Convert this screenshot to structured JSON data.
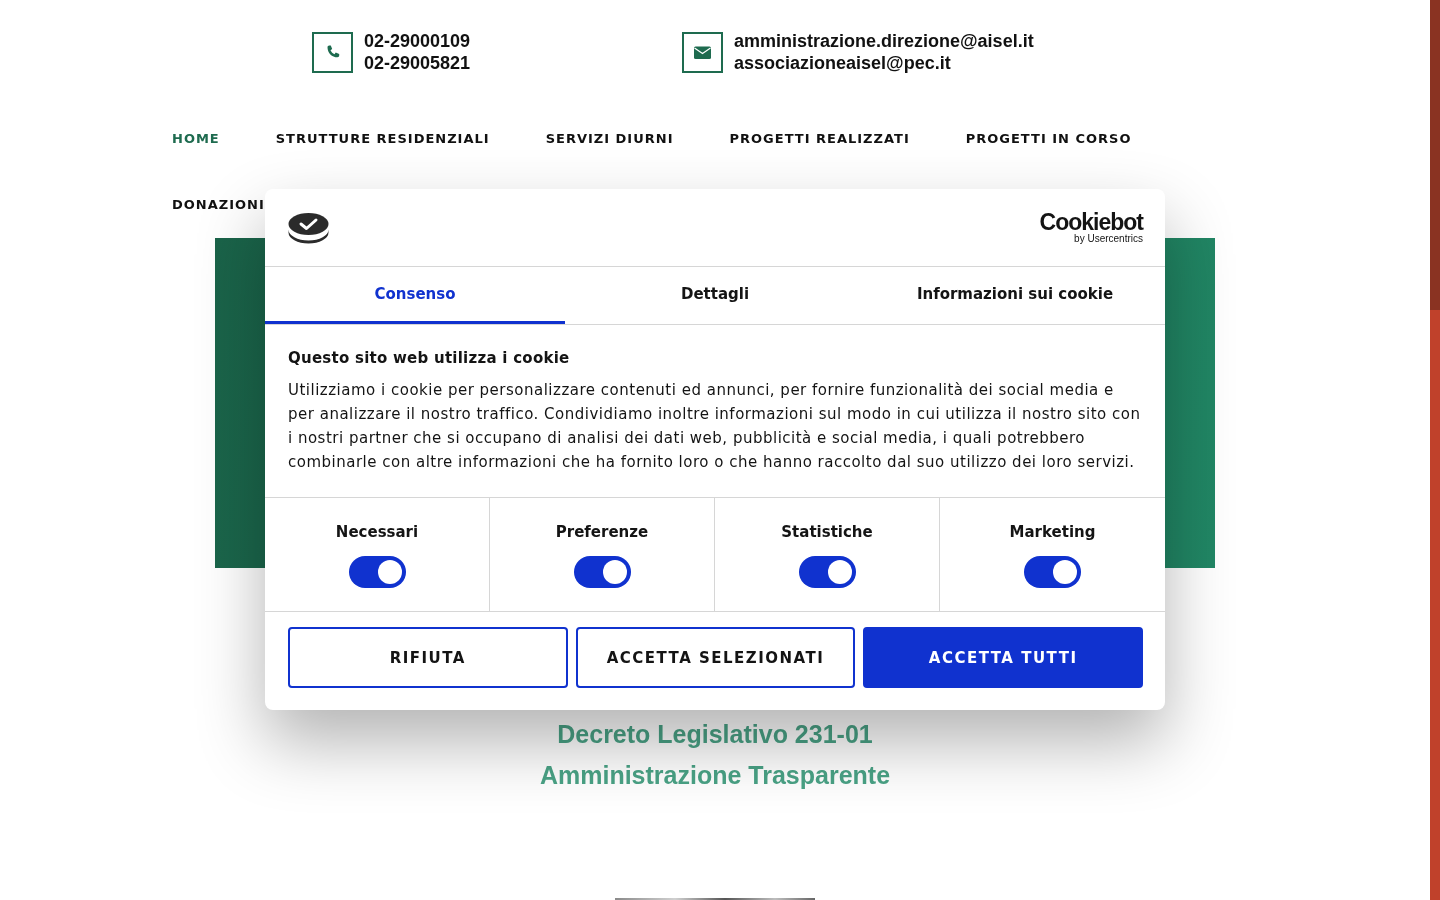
{
  "contacts": [
    {
      "kind": "phone",
      "lines": [
        "02-29000109",
        "02-29005821"
      ]
    },
    {
      "kind": "email",
      "lines": [
        "amministrazione.direzione@aisel.it",
        "associazioneaisel@pec.it"
      ]
    }
  ],
  "nav": [
    {
      "label": "HOME",
      "selected": true
    },
    {
      "label": "STRUTTURE RESIDENZIALI",
      "selected": false
    },
    {
      "label": "SERVIZI DIURNI",
      "selected": false
    },
    {
      "label": "PROGETTI REALIZZATI",
      "selected": false
    },
    {
      "label": "PROGETTI IN CORSO",
      "selected": false
    },
    {
      "label": "DONAZIONI",
      "selected": false
    }
  ],
  "links": [
    "Decreto Legislativo 231-01",
    "Amministrazione Trasparente"
  ],
  "cookie_dialog": {
    "brand": {
      "name": "Cookiebot",
      "tagline": "by Usercentrics"
    },
    "tabs": [
      {
        "label": "Consenso",
        "selected": true
      },
      {
        "label": "Dettagli",
        "selected": false
      },
      {
        "label": "Informazioni sui cookie",
        "selected": false
      }
    ],
    "title": "Questo sito web utilizza i cookie",
    "text": "Utilizziamo i cookie per personalizzare contenuti ed annunci, per fornire funzionalità dei social media e per analizzare il nostro traffico. Condividiamo inoltre informazioni sul modo in cui utilizza il nostro sito con i nostri partner che si occupano di analisi dei dati web, pubblicità e social media, i quali potrebbero combinarle con altre informazioni che ha fornito loro o che hanno raccolto dal suo utilizzo dei loro servizi.",
    "categories": [
      {
        "label": "Necessari",
        "checked": true
      },
      {
        "label": "Preferenze",
        "checked": true
      },
      {
        "label": "Statistiche",
        "checked": true
      },
      {
        "label": "Marketing",
        "checked": true
      }
    ],
    "buttons": [
      {
        "label": "RIFIUTA",
        "kind": "outline"
      },
      {
        "label": "ACCETTA SELEZIONATI",
        "kind": "outline"
      },
      {
        "label": "ACCETTA TUTTI",
        "kind": "primary"
      }
    ]
  }
}
